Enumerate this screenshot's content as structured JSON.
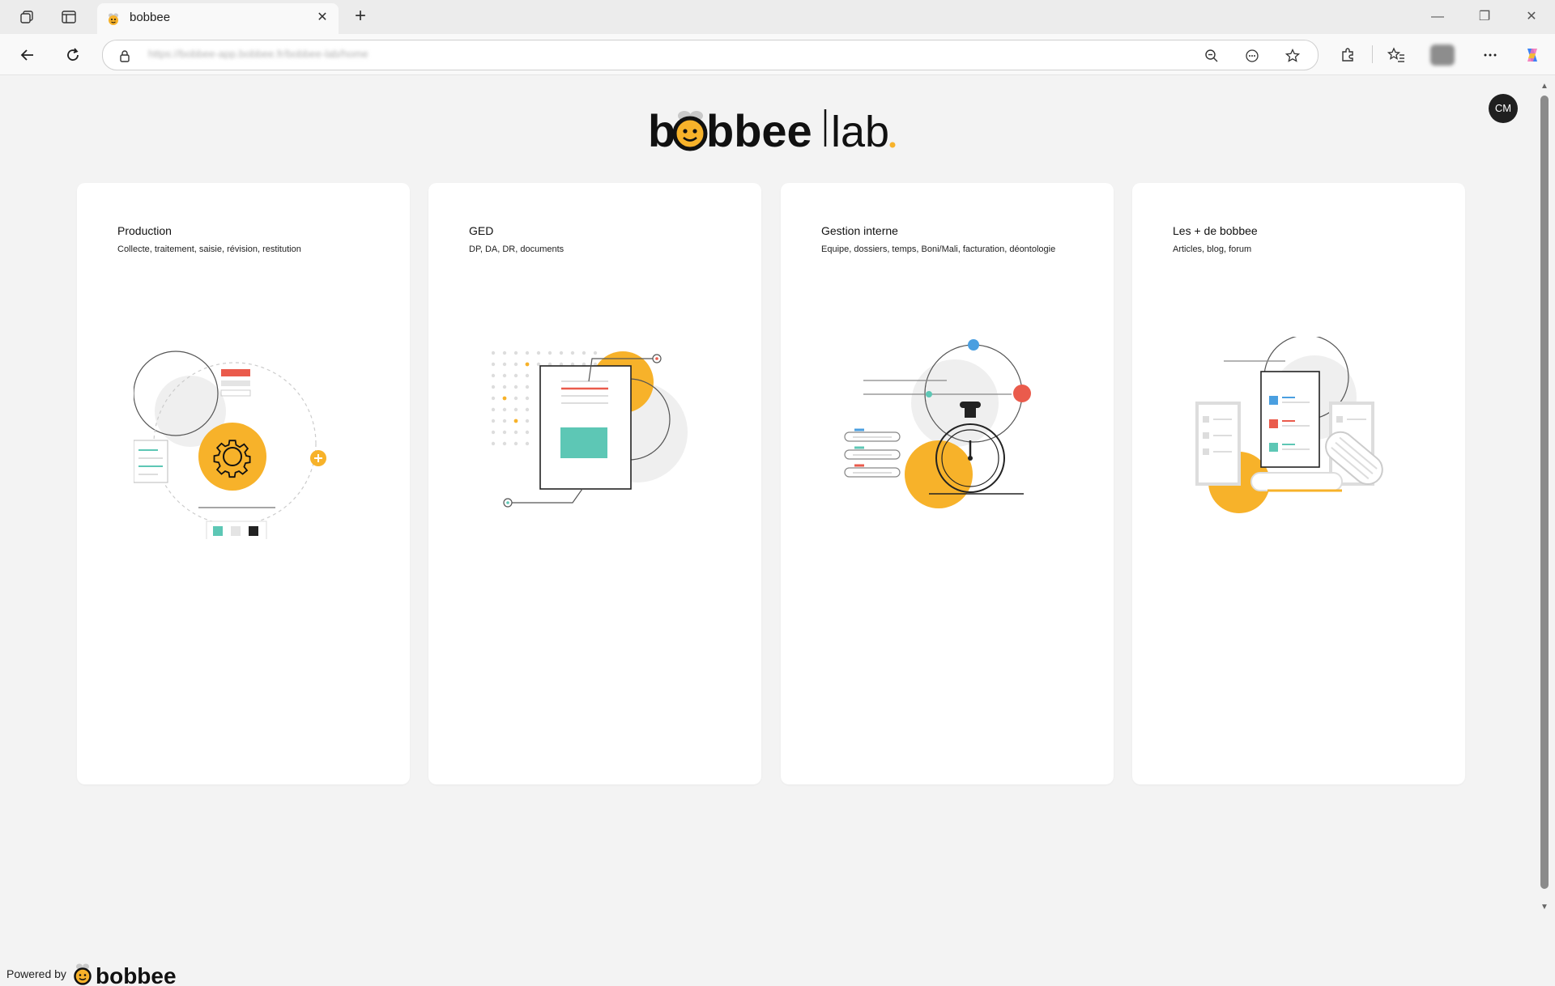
{
  "browser": {
    "tab_title": "bobbee",
    "url_blurred": "https://bobbee-app.bobbee.fr/bobbee-lab/home"
  },
  "page": {
    "logo_text_main": "bobbee",
    "logo_text_lab": "lab",
    "avatar_initials": "CM",
    "powered_by": "Powered by",
    "powered_brand": "bobbee"
  },
  "cards": [
    {
      "title": "Production",
      "desc": "Collecte, traitement, saisie, révision, restitution"
    },
    {
      "title": "GED",
      "desc": "DP, DA, DR, documents"
    },
    {
      "title": "Gestion interne",
      "desc": "Equipe, dossiers, temps, Boni/Mali, facturation, déontologie"
    },
    {
      "title": "Les + de bobbee",
      "desc": "Articles, blog, forum"
    }
  ],
  "colors": {
    "accent_yellow": "#f7b22a",
    "teal": "#5dc7b5",
    "coral": "#ea5b4c",
    "blue": "#4a9fe0",
    "dark": "#1f1f1f"
  }
}
